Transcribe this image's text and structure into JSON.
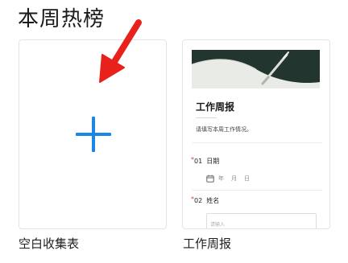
{
  "section": {
    "title": "本周热榜"
  },
  "templates": [
    {
      "caption": "空白收集表",
      "icon": "plus-icon"
    },
    {
      "caption": "工作周报",
      "preview": {
        "cover_image": "pen-on-paper-photo",
        "form_title": "工作周报",
        "description": "请填写本周工作情况。",
        "questions": [
          {
            "number": "01",
            "label": "日期",
            "required": true,
            "date_parts": [
              "年",
              "月",
              "日"
            ]
          },
          {
            "number": "02",
            "label": "姓名",
            "required": true,
            "placeholder": "请输入"
          }
        ]
      }
    }
  ],
  "annotation": {
    "icon": "red-arrow-icon"
  },
  "colors": {
    "accent_blue": "#1a87e6",
    "required_red": "#e53935",
    "annotation_red": "#e8211d"
  }
}
